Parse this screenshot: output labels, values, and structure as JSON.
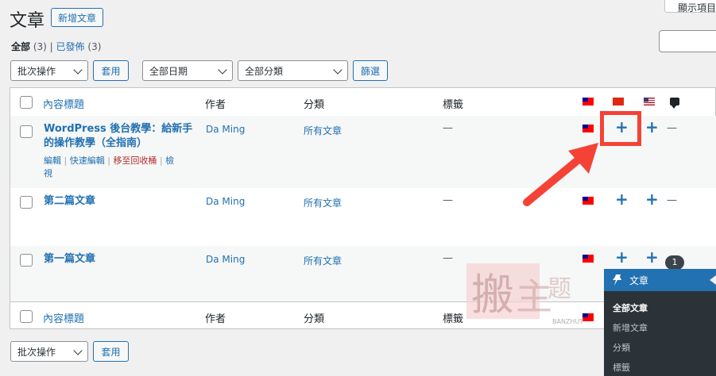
{
  "header": {
    "title": "文章",
    "add_new": "新增文章",
    "screen_options": "顯示項目"
  },
  "views": {
    "all_label": "全部",
    "all_count": "(3)",
    "sep": "|",
    "published_label": "已發佈",
    "published_count": "(3)"
  },
  "filters": {
    "bulk_actions": "批次操作",
    "apply": "套用",
    "dates": "全部日期",
    "categories": "全部分類",
    "filter": "篩選"
  },
  "columns": {
    "title": "內容標題",
    "author": "作者",
    "categories": "分類",
    "tags": "標籤"
  },
  "rows": [
    {
      "title_line1": "WordPress 後台教學：給新手",
      "title_line2": "的操作教學（全指南）",
      "author": "Da Ming",
      "category": "所有文章",
      "tags": "—",
      "actions": {
        "edit": "編輯",
        "quick_edit": "快速編輯",
        "trash": "移至回收桶",
        "view_a": "檢",
        "view_b": "視",
        "sep": "|"
      },
      "comments": "—"
    },
    {
      "title": "第二篇文章",
      "author": "Da Ming",
      "category": "所有文章",
      "tags": "—",
      "comments": "—"
    },
    {
      "title": "第一篇文章",
      "author": "Da Ming",
      "category": "所有文章",
      "tags": "—",
      "comment_badge": "1"
    }
  ],
  "translation_plus": "+",
  "flyout": {
    "heading": "文章",
    "items": [
      "全部文章",
      "新增文章",
      "分類",
      "標籤"
    ]
  },
  "watermark": {
    "text": "搬主題",
    "url": "BANZHUTI.COM"
  },
  "colors": {
    "accent": "#2271b1",
    "highlight": "#f44336",
    "trash": "#b32d2e"
  },
  "icons": {
    "pin": "pushpin-icon",
    "comment": "comment-bubble-icon"
  }
}
